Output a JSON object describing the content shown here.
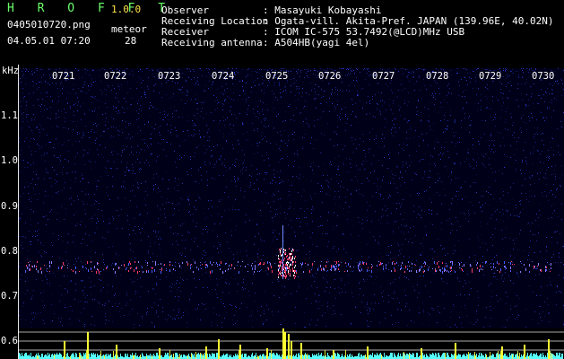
{
  "app": {
    "title": "H R O F F T",
    "version": "1.0.0"
  },
  "file": {
    "name": "0405010720.png",
    "datetime": "04.05.01 07:20"
  },
  "meteor": {
    "label": "meteor",
    "count": "28"
  },
  "info": {
    "observer_label": "Observer",
    "observer_value": ": Masayuki Kobayashi",
    "location_label": "Receiving Location",
    "location_value": ": Ogata-vill. Akita-Pref. JAPAN (139.96E, 40.02N)",
    "receiver_label": "Receiver",
    "receiver_value": ": ICOM IC-575 53.7492(@LCD)MHz USB",
    "antenna_label": "Receiving antenna",
    "antenna_value": ": A504HB(yagi 4el)"
  },
  "axis": {
    "unit": "kHz",
    "y_ticks": [
      "1.1",
      "1.0",
      "0.9",
      "0.8",
      "0.7",
      "0.6"
    ],
    "time_ticks": [
      "0721",
      "0722",
      "0723",
      "0724",
      "0725",
      "0726",
      "0727",
      "0728",
      "0729",
      "0730"
    ]
  },
  "colors": {
    "title": "#6bff6b",
    "version": "#ffe24a",
    "spectrogram_bg": "#000018",
    "noise": "#2a3bd6",
    "echo": "#ff3b6a",
    "histogram": "#ffff33",
    "baseline": "#55ffff"
  }
}
